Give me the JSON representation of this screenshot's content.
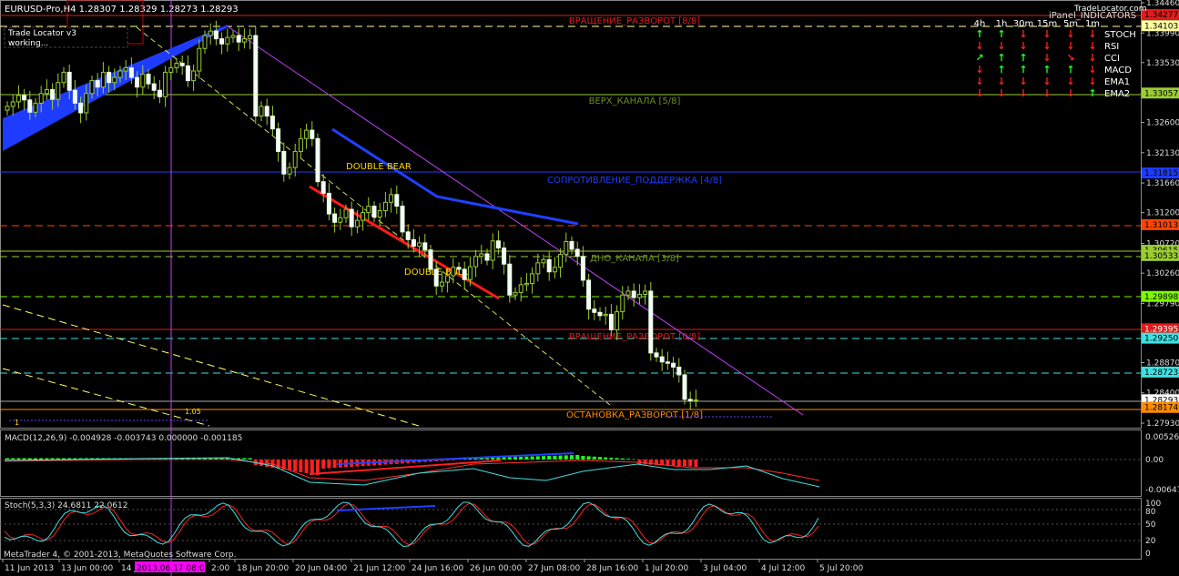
{
  "main": {
    "header": "EURUSD-Pro,H4  1.28307 1.28329 1.28273 1.28293",
    "trade_locator_title": "Trade Locator v3",
    "trade_locator_status": "working...",
    "scale_labels": [
      "1.34460",
      "1.33990",
      "1.33530",
      "1.33060",
      "1.32600",
      "1.32130",
      "1.31660",
      "1.31200",
      "1.30720",
      "1.30260",
      "1.29790",
      "1.29330",
      "1.28870",
      "1.28400",
      "1.27930"
    ],
    "price_tags": [
      {
        "value": "1.34277",
        "bg": "#e21b1b",
        "fg": "#000000"
      },
      {
        "value": "1.34103",
        "bg": "#ffffa0",
        "fg": "#000000"
      },
      {
        "value": "1.33057",
        "bg": "#9acd32",
        "fg": "#000000"
      },
      {
        "value": "1.31815",
        "bg": "#1e3cff",
        "fg": "#000000"
      },
      {
        "value": "1.31013",
        "bg": "#ff4500",
        "fg": "#000000"
      },
      {
        "value": "1.30615",
        "bg": "#9acd32",
        "fg": "#000000"
      },
      {
        "value": "1.30533",
        "bg": "#9acd32",
        "fg": "#000000"
      },
      {
        "value": "1.29898",
        "bg": "#7cfc00",
        "fg": "#000000"
      },
      {
        "value": "1.29395",
        "bg": "#e21b1b",
        "fg": "#ffffff"
      },
      {
        "value": "1.29250",
        "bg": "#40e0e0",
        "fg": "#000000"
      },
      {
        "value": "1.28723",
        "bg": "#40e0e0",
        "fg": "#000000"
      },
      {
        "value": "1.28293",
        "bg": "#ffffff",
        "fg": "#000000"
      },
      {
        "value": "1.28174",
        "bg": "#ff8c00",
        "fg": "#000000"
      }
    ],
    "levels": [
      {
        "label": "ВРАЩЕНИЕ_РАЗВОРОТ [8/8]",
        "color": "#e21b1b"
      },
      {
        "label": "ВЕРХ_КАНАЛА [5/8]",
        "color": "#6b8e23"
      },
      {
        "label": "СОПРОТИВЛЕНИЕ_ПОДДЕРЖКА [4/8]",
        "color": "#1e3cff"
      },
      {
        "label": "ДНО_КАНАЛА [3/8]",
        "color": "#6b8e23"
      },
      {
        "label": "ВРАЩЕНИЕ_РАЗВОРОТ [0/8]",
        "color": "#e21b1b"
      },
      {
        "label": "ОСТАНОВКА_РАЗВОРОТ [1/8]",
        "color": "#ff8c00"
      }
    ],
    "pattern_labels": [
      "DOUBLE  BEAR",
      "DOUBLE  BULL"
    ],
    "small_labels": [
      "1.05",
      "1"
    ]
  },
  "panel": {
    "title": "iPanel_INDICATORS",
    "brand": "TradeLocator.com",
    "timeframes": [
      "4h",
      "1h",
      "30m",
      "15m",
      "5m",
      "1m"
    ],
    "rows": [
      {
        "name": "STOCH",
        "signals": [
          "up",
          "up",
          "down",
          "down",
          "down",
          "down"
        ]
      },
      {
        "name": "RSI",
        "signals": [
          "down",
          "down",
          "down",
          "down",
          "down",
          "down"
        ]
      },
      {
        "name": "CCI",
        "signals": [
          "up-diag",
          "up",
          "up",
          "down",
          "down-diag",
          "down"
        ]
      },
      {
        "name": "MACD",
        "signals": [
          "down",
          "up",
          "up",
          "up",
          "up",
          "down"
        ]
      },
      {
        "name": "EMA1",
        "signals": [
          "down",
          "down",
          "down",
          "down",
          "down",
          "down"
        ]
      },
      {
        "name": "EMA2",
        "signals": [
          "down",
          "down",
          "down",
          "down",
          "down",
          "up"
        ]
      }
    ]
  },
  "macd": {
    "header": "MACD(12,26,9) -0.004928 -0.003743 0.000000 -0.001185",
    "scale": [
      "0.00526",
      "0.00",
      "-0.00647"
    ]
  },
  "stoch": {
    "header": "Stoch(5,3,3) 24.6811 22.0612",
    "scale": [
      "100",
      "80",
      "50",
      "20",
      "0"
    ]
  },
  "x_axis": {
    "labels": [
      "11 Jun 2013",
      "13 Jun 00:00",
      "14 J",
      "2013.06.17 08:00",
      "2:00",
      "18 Jun 20:00",
      "20 Jun 04:00",
      "21 Jun 12:00",
      "24 Jun 16:00",
      "26 Jun 00:00",
      "27 Jun 08:00",
      "28 Jun 16:00",
      "1 Jul 20:00",
      "3 Jul 04:00",
      "4 Jul 12:00",
      "5 Jul 20:00"
    ]
  },
  "footer": "MetaTrader 4, © 2001-2013, MetaQuotes Software Corp.",
  "chart_data": {
    "type": "candlestick",
    "symbol": "EURUSD-Pro",
    "timeframe": "H4",
    "ylim": [
      1.2793,
      1.3446
    ],
    "closes": [
      1.3285,
      1.3292,
      1.3302,
      1.3295,
      1.3276,
      1.329,
      1.3305,
      1.3311,
      1.3296,
      1.3322,
      1.3338,
      1.331,
      1.329,
      1.3275,
      1.3305,
      1.3325,
      1.3315,
      1.3338,
      1.3322,
      1.333,
      1.334,
      1.3345,
      1.333,
      1.3315,
      1.3335,
      1.332,
      1.331,
      1.33,
      1.3338,
      1.3345,
      1.3352,
      1.3348,
      1.3325,
      1.334,
      1.3375,
      1.3395,
      1.3402,
      1.339,
      1.3382,
      1.3392,
      1.3395,
      1.3385,
      1.339,
      1.3395,
      1.327,
      1.3285,
      1.327,
      1.325,
      1.3215,
      1.318,
      1.319,
      1.3215,
      1.3235,
      1.3248,
      1.3235,
      1.3168,
      1.315,
      1.3118,
      1.3105,
      1.3112,
      1.3125,
      1.3098,
      1.3108,
      1.312,
      1.313,
      1.3113,
      1.3123,
      1.3136,
      1.3148,
      1.313,
      1.309,
      1.3078,
      1.3068,
      1.3073,
      1.3062,
      1.3032,
      1.3006,
      1.3012,
      1.3022,
      1.3035,
      1.3032,
      1.3016,
      1.3036,
      1.3052,
      1.3056,
      1.3046,
      1.3076,
      1.3065,
      1.304,
      1.2992,
      1.2996,
      1.3008,
      1.301,
      1.3025,
      1.3042,
      1.3047,
      1.3028,
      1.3035,
      1.3055,
      1.3075,
      1.3063,
      1.3052,
      1.3015,
      1.297,
      1.2965,
      1.296,
      1.2962,
      1.2938,
      1.2966,
      1.2992,
      1.2998,
      1.2988,
      1.2993,
      1.2998,
      1.2902,
      1.2896,
      1.2888,
      1.2886,
      1.288,
      1.2868,
      1.283,
      1.2828,
      1.2829
    ]
  }
}
